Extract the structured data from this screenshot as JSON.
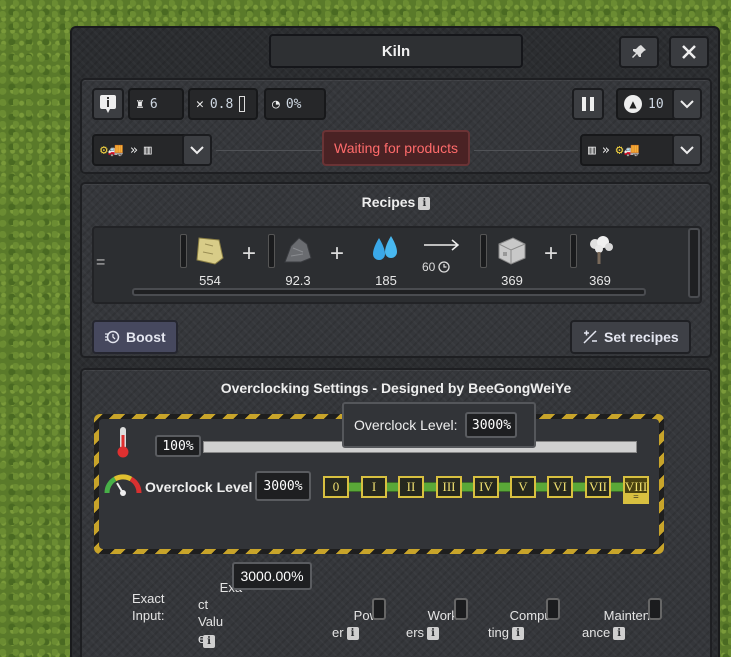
{
  "window": {
    "title": "Kiln",
    "pin_icon": "pin-icon",
    "close_icon": "close-icon"
  },
  "status_bar": {
    "workers_value": "6",
    "maintenance_value": "0.8",
    "efficiency_value": "0%",
    "status_text": "Waiting for products",
    "priority_value": "10"
  },
  "recipes": {
    "title": "Recipes",
    "info": "i",
    "inputs": [
      {
        "name": "limestone-icon",
        "amount": "554"
      },
      {
        "name": "slag-icon",
        "amount": "92.3"
      },
      {
        "name": "water-icon",
        "amount": "185"
      }
    ],
    "duration": "60",
    "outputs": [
      {
        "name": "bricks-icon",
        "amount": "369"
      },
      {
        "name": "exhaust-icon",
        "amount": "369"
      }
    ],
    "handle": "=",
    "boost_label": "Boost",
    "set_recipes_label": "Set recipes"
  },
  "overclock": {
    "section_title": "Overclocking Settings - Designed by BeeGongWeiYe",
    "tooltip_label": "Overclock Level:",
    "tooltip_value": "3000%",
    "temp_value": "100%",
    "level_label": "Overclock Level",
    "level_value": "3000%",
    "levels": [
      "0",
      "I",
      "II",
      "III",
      "IV",
      "V",
      "VI",
      "VII",
      "VIII"
    ],
    "selected_level_marker": "=",
    "exact_input_label": "Exact\nInput:",
    "exact_value_label": "Exa\nct\nValu\ne",
    "exact_value": "3000.00%",
    "toggles": [
      {
        "label": "Pow\ner",
        "info": "i"
      },
      {
        "label": "Work\ners",
        "info": "i"
      },
      {
        "label": "Compu\nting",
        "info": "i"
      },
      {
        "label": "Mainten\nance",
        "info": "i"
      }
    ]
  },
  "colors": {
    "accent_status": "#ff6b6b",
    "hazard_yellow": "#c8a42a",
    "level_highlight": "#d8c040",
    "progress_green": "#5aa838"
  }
}
